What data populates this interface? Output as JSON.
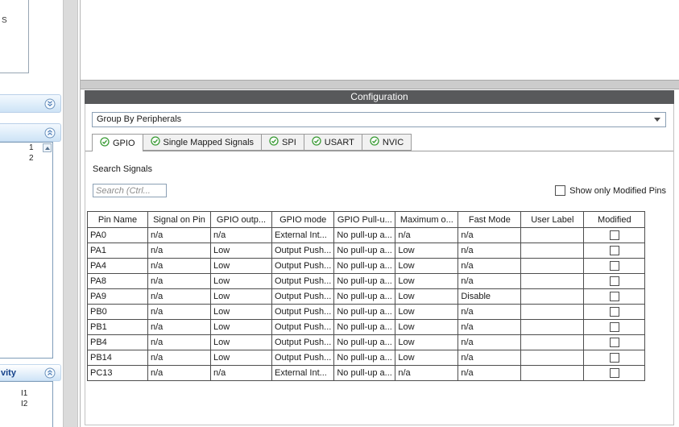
{
  "sidebar": {
    "top_fragment": "S",
    "list_top": [
      "1",
      "2"
    ],
    "category_label": "vity",
    "list_bottom": [
      "I1",
      "I2"
    ]
  },
  "configuration": {
    "title": "Configuration",
    "group_by": {
      "value": "Group By Peripherals"
    },
    "tabs": [
      {
        "label": "GPIO",
        "selected": true
      },
      {
        "label": "Single Mapped Signals",
        "selected": false
      },
      {
        "label": "SPI",
        "selected": false
      },
      {
        "label": "USART",
        "selected": false
      },
      {
        "label": "NVIC",
        "selected": false
      }
    ],
    "search": {
      "label": "Search Signals",
      "placeholder": "Search (Ctrl..."
    },
    "show_modified": {
      "label": "Show only Modified Pins",
      "checked": false
    },
    "table": {
      "columns": [
        "Pin Name",
        "Signal on Pin",
        "GPIO outp...",
        "GPIO mode",
        "GPIO Pull-u...",
        "Maximum o...",
        "Fast Mode",
        "User Label",
        "Modified"
      ],
      "rows": [
        [
          "PA0",
          "n/a",
          "n/a",
          "External Int...",
          "No pull-up a...",
          "n/a",
          "n/a",
          "",
          false
        ],
        [
          "PA1",
          "n/a",
          "Low",
          "Output Push...",
          "No pull-up a...",
          "Low",
          "n/a",
          "",
          false
        ],
        [
          "PA4",
          "n/a",
          "Low",
          "Output Push...",
          "No pull-up a...",
          "Low",
          "n/a",
          "",
          false
        ],
        [
          "PA8",
          "n/a",
          "Low",
          "Output Push...",
          "No pull-up a...",
          "Low",
          "n/a",
          "",
          false
        ],
        [
          "PA9",
          "n/a",
          "Low",
          "Output Push...",
          "No pull-up a...",
          "Low",
          "Disable",
          "",
          false
        ],
        [
          "PB0",
          "n/a",
          "Low",
          "Output Push...",
          "No pull-up a...",
          "Low",
          "n/a",
          "",
          false
        ],
        [
          "PB1",
          "n/a",
          "Low",
          "Output Push...",
          "No pull-up a...",
          "Low",
          "n/a",
          "",
          false
        ],
        [
          "PB4",
          "n/a",
          "Low",
          "Output Push...",
          "No pull-up a...",
          "Low",
          "n/a",
          "",
          false
        ],
        [
          "PB14",
          "n/a",
          "Low",
          "Output Push...",
          "No pull-up a...",
          "Low",
          "n/a",
          "",
          false
        ],
        [
          "PC13",
          "n/a",
          "n/a",
          "External Int...",
          "No pull-up a...",
          "n/a",
          "n/a",
          "",
          false
        ]
      ]
    }
  },
  "colors": {
    "config_header_bg": "#58595b",
    "tab_check_green": "#3a9b35",
    "category_text_blue": "#15428b"
  }
}
